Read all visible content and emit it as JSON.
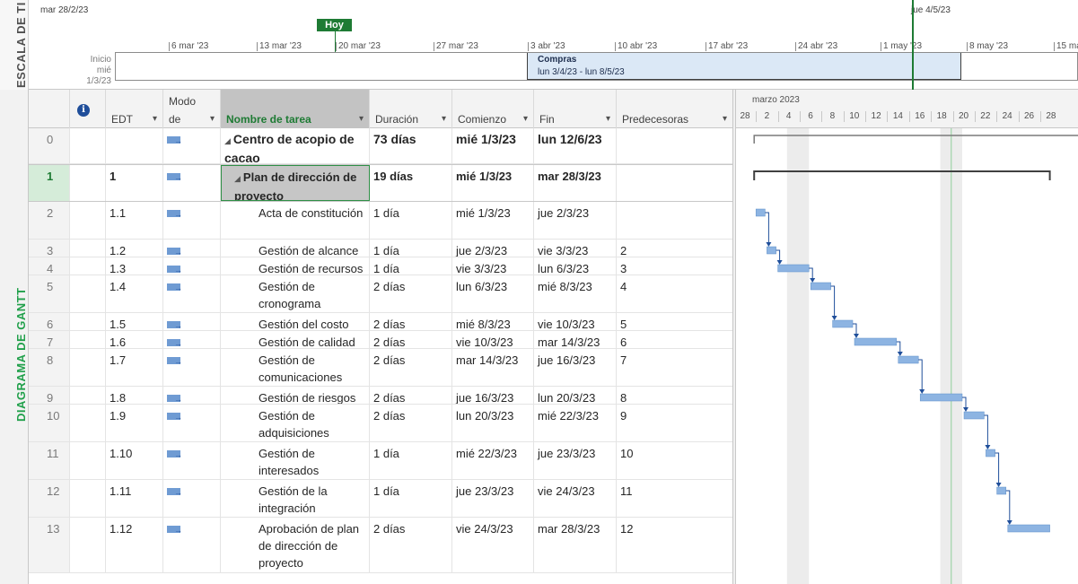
{
  "timeline": {
    "side_label": "ESCALA DE TI",
    "start_date": "mar 28/2/23",
    "end_date": "jue 4/5/23",
    "today_label": "Hoy",
    "start_label": "Inicio",
    "start_value": "mié 1/3/23",
    "ticks": [
      "6 mar '23",
      "13 mar '23",
      "20 mar '23",
      "27 mar '23",
      "3 abr '23",
      "10 abr '23",
      "17 abr '23",
      "24 abr '23",
      "1 may '23",
      "8 may '23",
      "15 ma"
    ],
    "task_name": "Compras",
    "task_dates": "lun 3/4/23 - lun 8/5/23"
  },
  "gantt": {
    "side_label": "DIAGRAMA DE GANTT",
    "columns": {
      "edt": "EDT",
      "modo_top": "Modo",
      "modo_bottom": "de",
      "name": "Nombre de tarea",
      "dur": "Duración",
      "start": "Comienzo",
      "end": "Fin",
      "pred": "Predecesoras"
    },
    "rows": [
      {
        "id": "0",
        "edt": "",
        "name": "Centro de acopio de cacao",
        "dur": "73 días",
        "start": "mié 1/3/23",
        "end": "lun 12/6/23",
        "pred": ""
      },
      {
        "id": "1",
        "edt": "1",
        "name": "Plan de dirección de proyecto",
        "dur": "19 días",
        "start": "mié 1/3/23",
        "end": "mar 28/3/23",
        "pred": ""
      },
      {
        "id": "2",
        "edt": "1.1",
        "name": "Acta de constitución",
        "dur": "1 día",
        "start": "mié 1/3/23",
        "end": "jue 2/3/23",
        "pred": ""
      },
      {
        "id": "3",
        "edt": "1.2",
        "name": "Gestión de alcance",
        "dur": "1 día",
        "start": "jue 2/3/23",
        "end": "vie 3/3/23",
        "pred": "2"
      },
      {
        "id": "4",
        "edt": "1.3",
        "name": "Gestión de recursos",
        "dur": "1 día",
        "start": "vie 3/3/23",
        "end": "lun 6/3/23",
        "pred": "3"
      },
      {
        "id": "5",
        "edt": "1.4",
        "name": "Gestión de cronograma",
        "dur": "2 días",
        "start": "lun 6/3/23",
        "end": "mié 8/3/23",
        "pred": "4"
      },
      {
        "id": "6",
        "edt": "1.5",
        "name": "Gestión del costo",
        "dur": "2 días",
        "start": "mié 8/3/23",
        "end": "vie 10/3/23",
        "pred": "5"
      },
      {
        "id": "7",
        "edt": "1.6",
        "name": "Gestión de calidad",
        "dur": "2 días",
        "start": "vie 10/3/23",
        "end": "mar 14/3/23",
        "pred": "6"
      },
      {
        "id": "8",
        "edt": "1.7",
        "name": "Gestión de comunicaciones",
        "dur": "2 días",
        "start": "mar 14/3/23",
        "end": "jue 16/3/23",
        "pred": "7"
      },
      {
        "id": "9",
        "edt": "1.8",
        "name": "Gestión de riesgos",
        "dur": "2 días",
        "start": "jue 16/3/23",
        "end": "lun 20/3/23",
        "pred": "8"
      },
      {
        "id": "10",
        "edt": "1.9",
        "name": "Gestión de adquisiciones",
        "dur": "2 días",
        "start": "lun 20/3/23",
        "end": "mié 22/3/23",
        "pred": "9"
      },
      {
        "id": "11",
        "edt": "1.10",
        "name": "Gestión de interesados",
        "dur": "1 día",
        "start": "mié 22/3/23",
        "end": "jue 23/3/23",
        "pred": "10"
      },
      {
        "id": "12",
        "edt": "1.11",
        "name": "Gestión de la integración",
        "dur": "1 día",
        "start": "jue 23/3/23",
        "end": "vie 24/3/23",
        "pred": "11"
      },
      {
        "id": "13",
        "edt": "1.12",
        "name": "Aprobación de plan de dirección de proyecto",
        "dur": "2 días",
        "start": "vie 24/3/23",
        "end": "mar 28/3/23",
        "pred": "12"
      }
    ]
  },
  "chart": {
    "month_label": "marzo 2023",
    "day_labels": [
      "28",
      "2",
      "4",
      "6",
      "8",
      "10",
      "12",
      "14",
      "16",
      "18",
      "20",
      "22",
      "24",
      "26",
      "28"
    ]
  },
  "colors": {
    "accent_green": "#1e7b34",
    "task_bar": "#8db4e2",
    "summary_bar": "#404040",
    "timeline_task": "#dbe8f6"
  }
}
